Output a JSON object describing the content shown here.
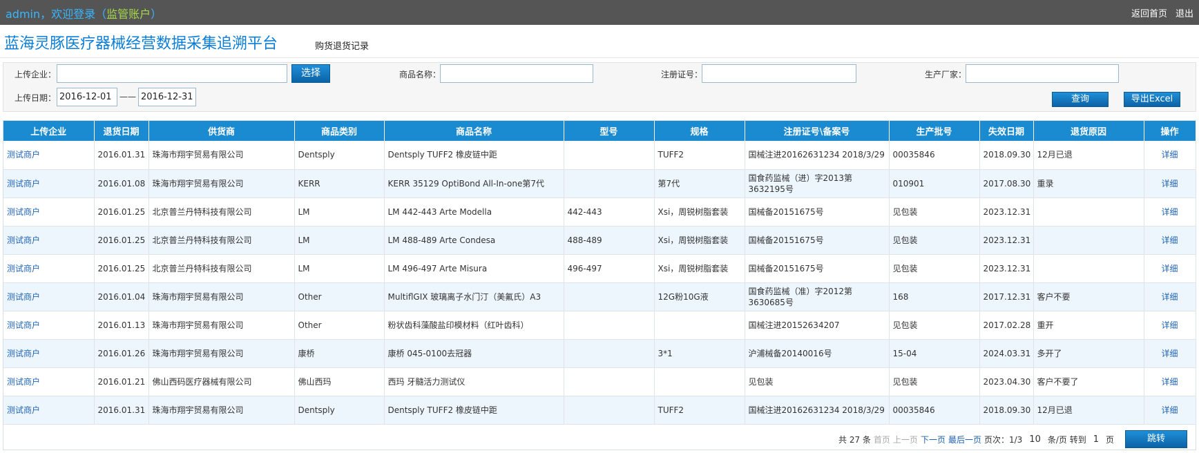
{
  "topbar": {
    "user": "admin",
    "welcome": "，欢迎登录（",
    "account_type": "监管账户",
    "close_paren": "）",
    "home_link": "返回首页",
    "logout_link": "退出"
  },
  "header": {
    "title": "蓝海灵豚医疗器械经营数据采集追溯平台",
    "subtitle": "购货退货记录"
  },
  "filters": {
    "company_label": "上传企业：",
    "company_value": "",
    "select_button": "选择",
    "product_label": "商品名称：",
    "product_value": "",
    "reg_label": "注册证号：",
    "reg_value": "",
    "maker_label": "生产厂家：",
    "maker_value": "",
    "date_label": "上传日期：",
    "date_from": "2016-12-01",
    "date_sep": "——",
    "date_to": "2016-12-31",
    "query_button": "查询",
    "excel_button": "导出Excel"
  },
  "table": {
    "headers": [
      "上传企业",
      "退货日期",
      "供货商",
      "商品类别",
      "商品名称",
      "型号",
      "规格",
      "注册证号\\备案号",
      "生产批号",
      "失效日期",
      "退货原因",
      "操作"
    ],
    "rows": [
      {
        "company": "测试商户",
        "date": "2016.01.31",
        "supplier": "珠海市翔宇贸易有限公司",
        "category": "Dentsply",
        "product": "Dentsply TUFF2 橡皮链中距",
        "model": "",
        "spec": "TUFF2",
        "reg": "国械注进20162631234 2018/3/29",
        "batch": "00035846",
        "expiry": "2018.09.30",
        "reason": "12月已退",
        "op": "详细"
      },
      {
        "company": "测试商户",
        "date": "2016.01.08",
        "supplier": "珠海市翔宇贸易有限公司",
        "category": "KERR",
        "product": "KERR 35129 OptiBond All-In-one第7代",
        "model": "",
        "spec": "第7代",
        "reg": "国食药监械（进）字2013第3632195号",
        "batch": "010901",
        "expiry": "2017.08.30",
        "reason": "重录",
        "op": "详细"
      },
      {
        "company": "测试商户",
        "date": "2016.01.25",
        "supplier": "北京普兰丹特科技有限公司",
        "category": "LM",
        "product": "LM 442-443 Arte Modella",
        "model": "442-443",
        "spec": "Xsi，周锐树脂套装",
        "reg": "国械备20151675号",
        "batch": "见包装",
        "expiry": "2023.12.31",
        "reason": "",
        "op": "详细"
      },
      {
        "company": "测试商户",
        "date": "2016.01.25",
        "supplier": "北京普兰丹特科技有限公司",
        "category": "LM",
        "product": "LM 488-489 Arte Condesa",
        "model": "488-489",
        "spec": "Xsi，周锐树脂套装",
        "reg": "国械备20151675号",
        "batch": "见包装",
        "expiry": "2023.12.31",
        "reason": "",
        "op": "详细"
      },
      {
        "company": "测试商户",
        "date": "2016.01.25",
        "supplier": "北京普兰丹特科技有限公司",
        "category": "LM",
        "product": "LM 496-497 Arte Misura",
        "model": "496-497",
        "spec": "Xsi，周锐树脂套装",
        "reg": "国械备20151675号",
        "batch": "见包装",
        "expiry": "2023.12.31",
        "reason": "",
        "op": "详细"
      },
      {
        "company": "测试商户",
        "date": "2016.01.04",
        "supplier": "珠海市翔宇贸易有限公司",
        "category": "Other",
        "product": "MultiflGIX 玻璃离子水门汀（美氟氏）A3",
        "model": "",
        "spec": "12G粉10G液",
        "reg": "国食药监械（准）字2012第3630685号",
        "batch": "168",
        "expiry": "2017.12.31",
        "reason": "客户不要",
        "op": "详细"
      },
      {
        "company": "测试商户",
        "date": "2016.01.13",
        "supplier": "珠海市翔宇贸易有限公司",
        "category": "Other",
        "product": "粉状齿科藻酸盐印模材料（红叶齿科）",
        "model": "",
        "spec": "",
        "reg": "国械注进20152634207",
        "batch": "见包装",
        "expiry": "2017.02.28",
        "reason": "重开",
        "op": "详细"
      },
      {
        "company": "测试商户",
        "date": "2016.01.26",
        "supplier": "珠海市翔宇贸易有限公司",
        "category": "康桥",
        "product": "康桥 045-0100去冠器",
        "model": "",
        "spec": "3*1",
        "reg": "沪浦械备20140016号",
        "batch": "15-04",
        "expiry": "2024.03.31",
        "reason": "多开了",
        "op": "详细"
      },
      {
        "company": "测试商户",
        "date": "2016.01.21",
        "supplier": "佛山西码医疗器械有限公司",
        "category": "佛山西玛",
        "product": "西玛 牙髓活力测试仪",
        "model": "",
        "spec": "",
        "reg": "见包装",
        "batch": "见包装",
        "expiry": "2023.04.30",
        "reason": "客户不要了",
        "op": "详细"
      },
      {
        "company": "测试商户",
        "date": "2016.01.31",
        "supplier": "珠海市翔宇贸易有限公司",
        "category": "Dentsply",
        "product": "Dentsply TUFF2 橡皮链中距",
        "model": "",
        "spec": "TUFF2",
        "reg": "国械注进20162631234 2018/3/29",
        "batch": "00035846",
        "expiry": "2018.09.30",
        "reason": "12月已退",
        "op": "详细"
      }
    ]
  },
  "pager": {
    "total": "共 27 条",
    "first": "首页",
    "prev": "上一页",
    "next": "下一页",
    "last": "最后一页",
    "page_info": "页次：1/3",
    "page_size": "10",
    "per_page": "条/页 转到",
    "goto_value": "1",
    "page_unit": "页",
    "go_button": "跳转"
  }
}
